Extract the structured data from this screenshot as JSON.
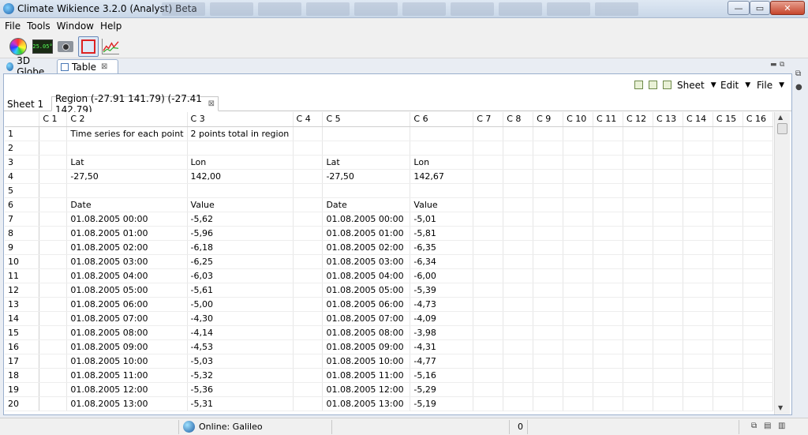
{
  "window": {
    "title": "Climate Wikience 3.2.0 (Analyst) Beta",
    "minimize_label": "—",
    "maximize_label": "▭",
    "close_label": "✕"
  },
  "menubar": [
    "File",
    "Tools",
    "Window",
    "Help"
  ],
  "toolbar": {
    "lcd_text": "25.05°"
  },
  "perspective_tabs": {
    "globe": "3D Globe",
    "table": "Table",
    "close_glyph": "⊠"
  },
  "sheet_menu": {
    "sheet": "Sheet",
    "edit": "Edit",
    "file": "File",
    "arrow": "▼"
  },
  "sheet_tabs": {
    "sheet1": "Sheet 1",
    "region": "Region (-27.91 141.79) (-27.41 142.79)",
    "close_glyph": "⊠"
  },
  "grid": {
    "columns": [
      "C 1",
      "C 2",
      "C 3",
      "C 4",
      "C 5",
      "C 6",
      "C 7",
      "C 8",
      "C 9",
      "C 10",
      "C 11",
      "C 12",
      "C 13",
      "C 14",
      "C 15",
      "C 16"
    ],
    "rows": [
      {
        "n": "1",
        "c": [
          "",
          "Time series for each point",
          "2 points total in region",
          "",
          "",
          ""
        ]
      },
      {
        "n": "2",
        "c": [
          "",
          "",
          "",
          "",
          "",
          ""
        ]
      },
      {
        "n": "3",
        "c": [
          "",
          "Lat",
          "Lon",
          "",
          "Lat",
          "Lon"
        ]
      },
      {
        "n": "4",
        "c": [
          "",
          "-27,50",
          "142,00",
          "",
          "-27,50",
          "142,67"
        ]
      },
      {
        "n": "5",
        "c": [
          "",
          "",
          "",
          "",
          "",
          ""
        ]
      },
      {
        "n": "6",
        "c": [
          "",
          "Date",
          "Value",
          "",
          "Date",
          "Value"
        ]
      },
      {
        "n": "7",
        "c": [
          "",
          "01.08.2005 00:00",
          "-5,62",
          "",
          "01.08.2005 00:00",
          "-5,01"
        ]
      },
      {
        "n": "8",
        "c": [
          "",
          "01.08.2005 01:00",
          "-5,96",
          "",
          "01.08.2005 01:00",
          "-5,81"
        ]
      },
      {
        "n": "9",
        "c": [
          "",
          "01.08.2005 02:00",
          "-6,18",
          "",
          "01.08.2005 02:00",
          "-6,35"
        ]
      },
      {
        "n": "10",
        "c": [
          "",
          "01.08.2005 03:00",
          "-6,25",
          "",
          "01.08.2005 03:00",
          "-6,34"
        ]
      },
      {
        "n": "11",
        "c": [
          "",
          "01.08.2005 04:00",
          "-6,03",
          "",
          "01.08.2005 04:00",
          "-6,00"
        ]
      },
      {
        "n": "12",
        "c": [
          "",
          "01.08.2005 05:00",
          "-5,61",
          "",
          "01.08.2005 05:00",
          "-5,39"
        ]
      },
      {
        "n": "13",
        "c": [
          "",
          "01.08.2005 06:00",
          "-5,00",
          "",
          "01.08.2005 06:00",
          "-4,73"
        ]
      },
      {
        "n": "14",
        "c": [
          "",
          "01.08.2005 07:00",
          "-4,30",
          "",
          "01.08.2005 07:00",
          "-4,09"
        ]
      },
      {
        "n": "15",
        "c": [
          "",
          "01.08.2005 08:00",
          "-4,14",
          "",
          "01.08.2005 08:00",
          "-3,98"
        ]
      },
      {
        "n": "16",
        "c": [
          "",
          "01.08.2005 09:00",
          "-4,53",
          "",
          "01.08.2005 09:00",
          "-4,31"
        ]
      },
      {
        "n": "17",
        "c": [
          "",
          "01.08.2005 10:00",
          "-5,03",
          "",
          "01.08.2005 10:00",
          "-4,77"
        ]
      },
      {
        "n": "18",
        "c": [
          "",
          "01.08.2005 11:00",
          "-5,32",
          "",
          "01.08.2005 11:00",
          "-5,16"
        ]
      },
      {
        "n": "19",
        "c": [
          "",
          "01.08.2005 12:00",
          "-5,36",
          "",
          "01.08.2005 12:00",
          "-5,29"
        ]
      },
      {
        "n": "20",
        "c": [
          "",
          "01.08.2005 13:00",
          "-5,31",
          "",
          "01.08.2005 13:00",
          "-5,19"
        ]
      }
    ]
  },
  "statusbar": {
    "online_text": "Online: Galileo",
    "counter": "0"
  }
}
